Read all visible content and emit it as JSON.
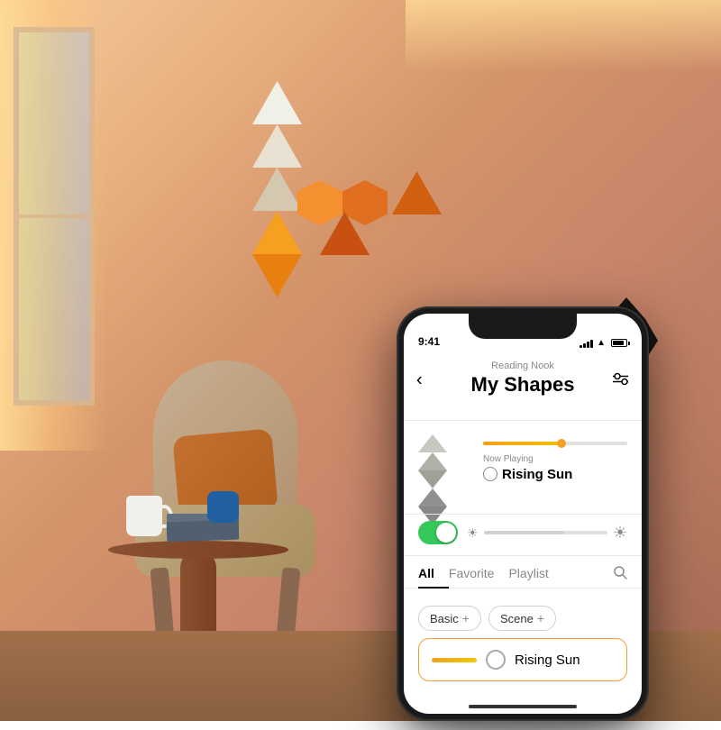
{
  "room": {
    "description": "Cozy reading nook with Nanoleaf light panels"
  },
  "phone": {
    "status_bar": {
      "time": "9:41",
      "signal": "signal",
      "wifi": "wifi",
      "battery": "battery"
    },
    "header": {
      "back_label": "‹",
      "subtitle": "Reading Nook",
      "title": "My Shapes",
      "settings_icon": "settings"
    },
    "now_playing": {
      "label": "Now Playing",
      "scene_name": "Rising Sun"
    },
    "brightness": {
      "toggle_state": "on",
      "level": "65"
    },
    "tabs": [
      {
        "label": "All",
        "active": true
      },
      {
        "label": "Favorite",
        "active": false
      },
      {
        "label": "Playlist",
        "active": false
      }
    ],
    "search_icon": "search",
    "categories": [
      {
        "label": "Basic",
        "has_plus": true
      },
      {
        "label": "Scene",
        "has_plus": true
      }
    ],
    "scenes": [
      {
        "name": "Rising Sun",
        "has_gradient": true
      }
    ]
  }
}
